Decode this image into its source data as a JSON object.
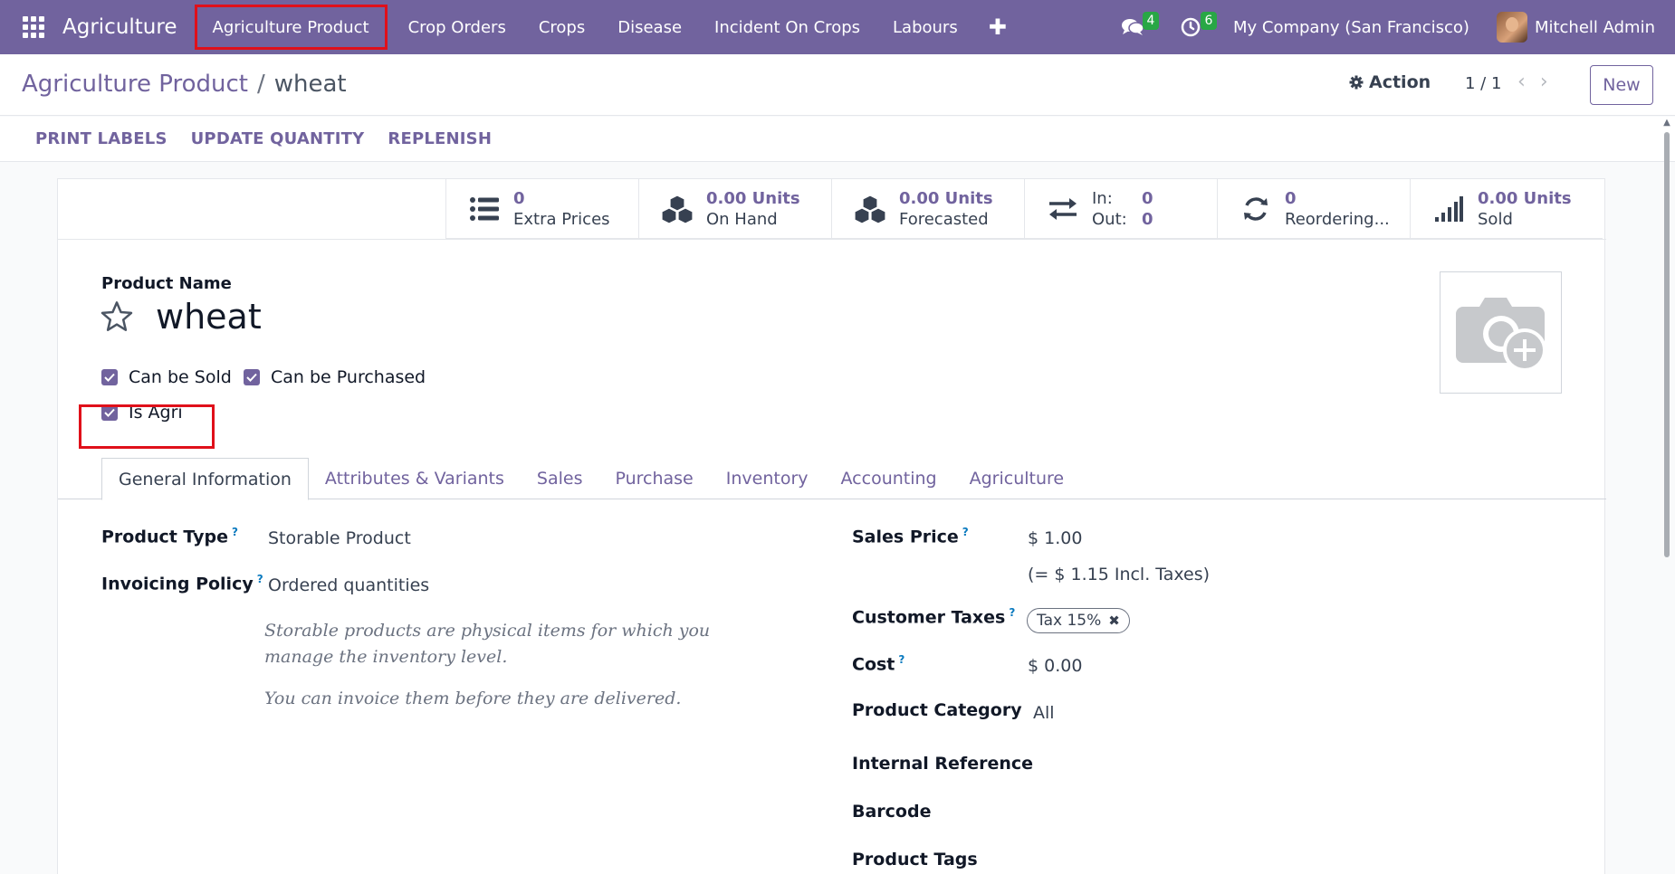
{
  "navbar": {
    "app_name": "Agriculture",
    "menu": [
      {
        "label": "Agriculture Product"
      },
      {
        "label": "Crop Orders"
      },
      {
        "label": "Crops"
      },
      {
        "label": "Disease"
      },
      {
        "label": "Incident On Crops"
      },
      {
        "label": "Labours"
      }
    ],
    "plus_label": "✚",
    "messages_count": "4",
    "activities_count": "6",
    "company": "My Company (San Francisco)",
    "user": "Mitchell Admin"
  },
  "control_panel": {
    "breadcrumb_parent": "Agriculture Product",
    "breadcrumb_sep": "/",
    "breadcrumb_current": "wheat",
    "action_label": "Action",
    "pager": "1 / 1",
    "new_label": "New"
  },
  "header_buttons": [
    "PRINT LABELS",
    "UPDATE QUANTITY",
    "REPLENISH"
  ],
  "stats": {
    "extra_prices_value": "0",
    "extra_prices_label": "Extra Prices",
    "on_hand_value": "0.00 Units",
    "on_hand_label": "On Hand",
    "forecasted_value": "0.00 Units",
    "forecasted_label": "Forecasted",
    "in_label": "In:",
    "in_value": "0",
    "out_label": "Out:",
    "out_value": "0",
    "reordering_value": "0",
    "reordering_label": "Reordering...",
    "sold_value": "0.00 Units",
    "sold_label": "Sold"
  },
  "form": {
    "product_name_label": "Product Name",
    "product_name": "wheat",
    "can_be_sold_label": "Can be Sold",
    "can_be_purchased_label": "Can be Purchased",
    "is_agri_label": "Is Agri",
    "can_be_sold": true,
    "can_be_purchased": true,
    "is_agri": true
  },
  "tabs": [
    "General Information",
    "Attributes & Variants",
    "Sales",
    "Purchase",
    "Inventory",
    "Accounting",
    "Agriculture"
  ],
  "general": {
    "product_type_label": "Product Type",
    "product_type": "Storable Product",
    "invoicing_policy_label": "Invoicing Policy",
    "invoicing_policy": "Ordered quantities",
    "help_1": "Storable products are physical items for which you manage the inventory level.",
    "help_2": "You can invoice them before they are delivered.",
    "sales_price_label": "Sales Price",
    "sales_price": "$ 1.00",
    "incl_taxes": "(= $ 1.15 Incl. Taxes)",
    "customer_taxes_label": "Customer Taxes",
    "tax_tag": "Tax 15%",
    "cost_label": "Cost",
    "cost": "$ 0.00",
    "product_category_label": "Product Category",
    "product_category": "All",
    "internal_reference_label": "Internal Reference",
    "barcode_label": "Barcode",
    "product_tags_label": "Product Tags"
  },
  "colors": {
    "navbar": "#71639e",
    "accent": "#71639e",
    "highlight": "#e0101a",
    "badge": "#28a745"
  }
}
